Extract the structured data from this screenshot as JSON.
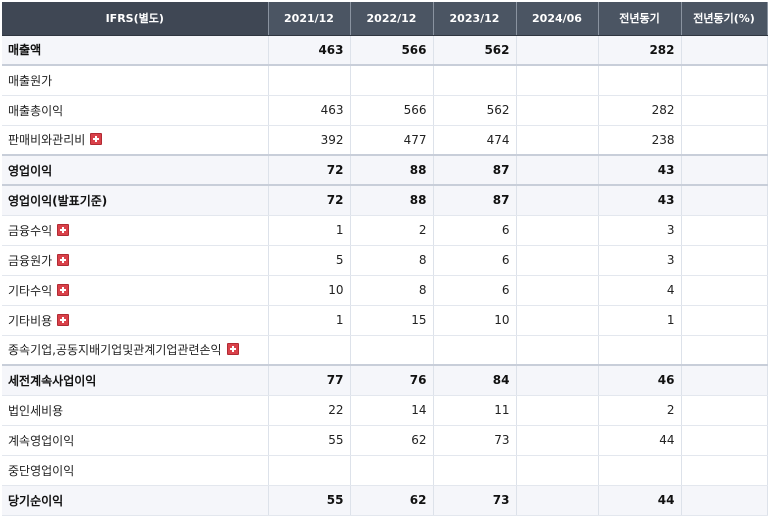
{
  "header": {
    "col0": "IFRS(별도)",
    "col1": "2021/12",
    "col2": "2022/12",
    "col3": "2023/12",
    "col4": "2024/06",
    "col5": "전년동기",
    "col6": "전년동기(%)"
  },
  "rows": [
    {
      "label": "매출액",
      "v1": "463",
      "v2": "566",
      "v3": "562",
      "v4": "",
      "v5": "282",
      "v6": "",
      "bold": true,
      "expand": false
    },
    {
      "label": "매출원가",
      "v1": "",
      "v2": "",
      "v3": "",
      "v4": "",
      "v5": "",
      "v6": "",
      "bold": false,
      "expand": false
    },
    {
      "label": "매출총이익",
      "v1": "463",
      "v2": "566",
      "v3": "562",
      "v4": "",
      "v5": "282",
      "v6": "",
      "bold": false,
      "expand": false
    },
    {
      "label": "판매비와관리비",
      "v1": "392",
      "v2": "477",
      "v3": "474",
      "v4": "",
      "v5": "238",
      "v6": "",
      "bold": false,
      "expand": true
    },
    {
      "label": "영업이익",
      "v1": "72",
      "v2": "88",
      "v3": "87",
      "v4": "",
      "v5": "43",
      "v6": "",
      "bold": true,
      "expand": false
    },
    {
      "label": "영업이익(발표기준)",
      "v1": "72",
      "v2": "88",
      "v3": "87",
      "v4": "",
      "v5": "43",
      "v6": "",
      "bold": true,
      "expand": false
    },
    {
      "label": "금융수익",
      "v1": "1",
      "v2": "2",
      "v3": "6",
      "v4": "",
      "v5": "3",
      "v6": "",
      "bold": false,
      "expand": true
    },
    {
      "label": "금융원가",
      "v1": "5",
      "v2": "8",
      "v3": "6",
      "v4": "",
      "v5": "3",
      "v6": "",
      "bold": false,
      "expand": true
    },
    {
      "label": "기타수익",
      "v1": "10",
      "v2": "8",
      "v3": "6",
      "v4": "",
      "v5": "4",
      "v6": "",
      "bold": false,
      "expand": true
    },
    {
      "label": "기타비용",
      "v1": "1",
      "v2": "15",
      "v3": "10",
      "v4": "",
      "v5": "1",
      "v6": "",
      "bold": false,
      "expand": true
    },
    {
      "label": "종속기업,공동지배기업및관계기업관련손익",
      "v1": "",
      "v2": "",
      "v3": "",
      "v4": "",
      "v5": "",
      "v6": "",
      "bold": false,
      "expand": true
    },
    {
      "label": "세전계속사업이익",
      "v1": "77",
      "v2": "76",
      "v3": "84",
      "v4": "",
      "v5": "46",
      "v6": "",
      "bold": true,
      "expand": false
    },
    {
      "label": "법인세비용",
      "v1": "22",
      "v2": "14",
      "v3": "11",
      "v4": "",
      "v5": "2",
      "v6": "",
      "bold": false,
      "expand": false
    },
    {
      "label": "계속영업이익",
      "v1": "55",
      "v2": "62",
      "v3": "73",
      "v4": "",
      "v5": "44",
      "v6": "",
      "bold": false,
      "expand": false
    },
    {
      "label": "중단영업이익",
      "v1": "",
      "v2": "",
      "v3": "",
      "v4": "",
      "v5": "",
      "v6": "",
      "bold": false,
      "expand": false
    },
    {
      "label": "당기순이익",
      "v1": "55",
      "v2": "62",
      "v3": "73",
      "v4": "",
      "v5": "44",
      "v6": "",
      "bold": true,
      "expand": false
    }
  ]
}
